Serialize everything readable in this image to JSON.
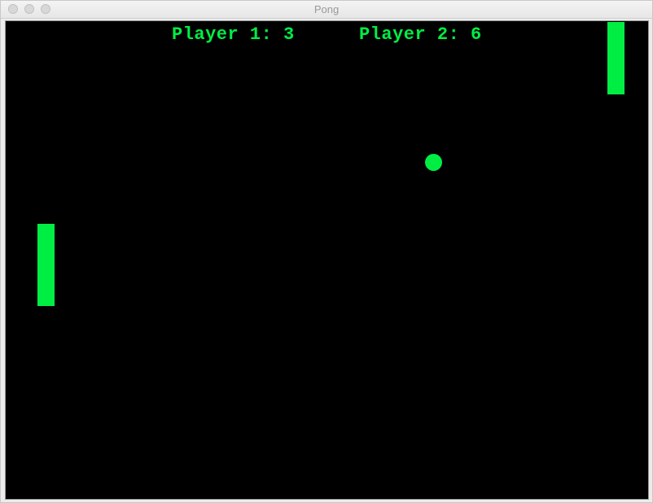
{
  "window": {
    "title": "Pong"
  },
  "game": {
    "player1_label": "Player 1: 3",
    "player2_label": "Player 2: 6",
    "player1_score": 3,
    "player2_score": 6
  },
  "colors": {
    "accent": "#00ee44",
    "background": "#000000"
  }
}
